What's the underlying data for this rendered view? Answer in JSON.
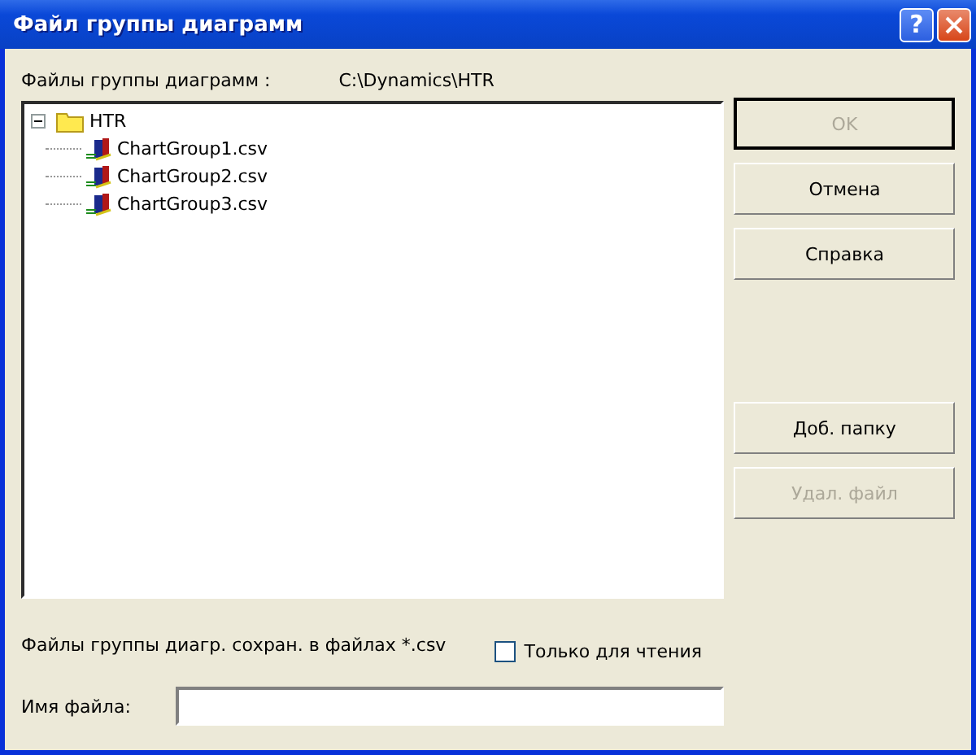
{
  "window": {
    "title": "Файл группы диаграмм",
    "help_button": "?"
  },
  "header": {
    "label": "Файлы группы диаграмм :",
    "path": "C:\\Dynamics\\HTR"
  },
  "tree": [
    {
      "label": "HTR",
      "kind": "folder",
      "expanded": true,
      "children": [
        {
          "label": "ChartGroup1.csv",
          "kind": "file"
        },
        {
          "label": "ChartGroup2.csv",
          "kind": "file"
        },
        {
          "label": "ChartGroup3.csv",
          "kind": "file"
        }
      ]
    }
  ],
  "note": "Файлы группы диагр. сохран. в файлах *.csv",
  "read_only": {
    "label": "Только для чтения",
    "checked": false
  },
  "filename": {
    "label": "Имя файла:"
  },
  "top_buttons": [
    {
      "label": "OK",
      "disabled": true,
      "default": true
    },
    {
      "label": "Отмена",
      "disabled": false,
      "default": false
    },
    {
      "label": "Справка",
      "disabled": false,
      "default": false
    }
  ],
  "bottom_buttons": [
    {
      "label": "Доб. папку",
      "disabled": false,
      "default": false
    },
    {
      "label": "Удал. файл",
      "disabled": true,
      "default": false
    }
  ]
}
